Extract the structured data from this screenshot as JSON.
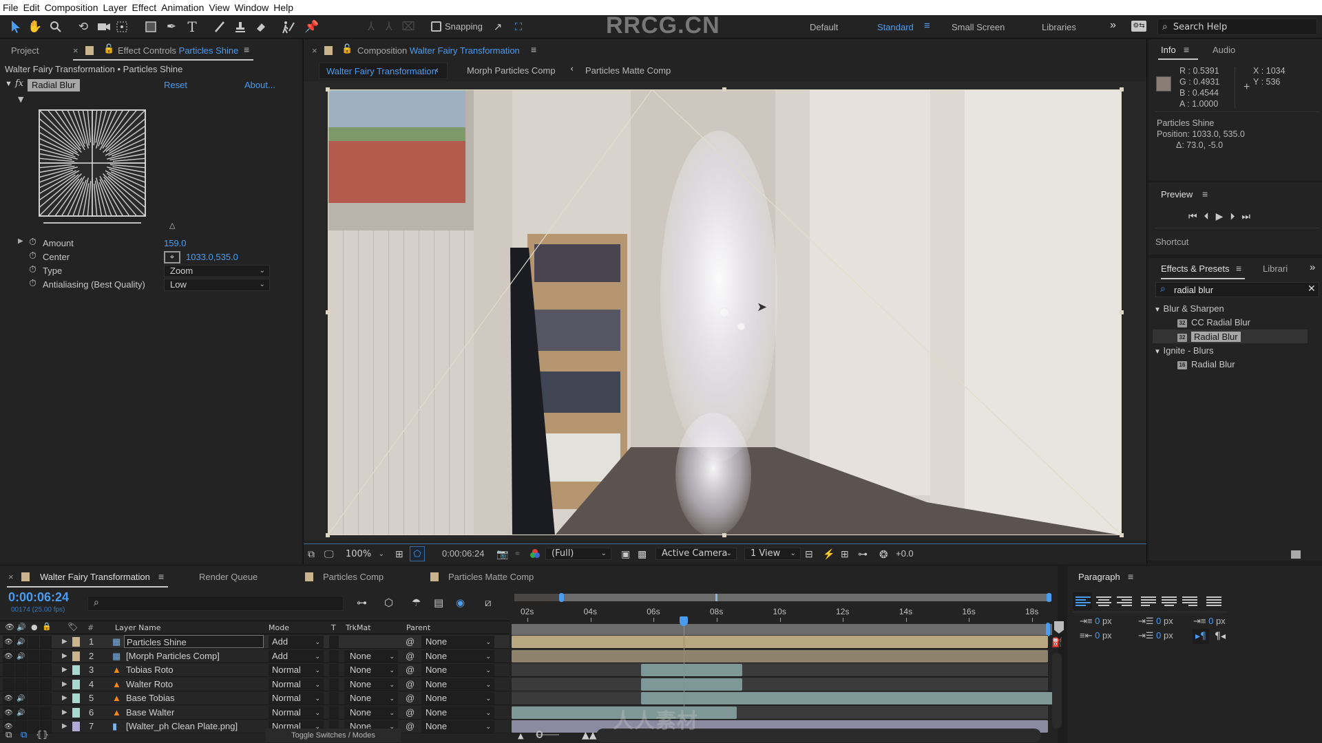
{
  "menubar": [
    "File",
    "Edit",
    "Composition",
    "Layer",
    "Effect",
    "Animation",
    "View",
    "Window",
    "Help"
  ],
  "toolbar": {
    "snapping_label": "Snapping",
    "workspaces": [
      "Default",
      "Standard",
      "Small Screen",
      "Libraries"
    ],
    "active_workspace": "Standard",
    "search_help_placeholder": "Search Help",
    "watermark": "RRCG.CN"
  },
  "left_panel": {
    "tab_project": "Project",
    "tab_effect_controls_prefix": "Effect Controls",
    "tab_effect_controls_layer": "Particles Shine",
    "breadcrumb": "Walter Fairy Transformation • Particles Shine",
    "effect": {
      "fx": "fx",
      "name": "Radial Blur",
      "reset": "Reset",
      "about": "About..."
    },
    "properties": [
      {
        "name": "Amount",
        "value": "159.0",
        "type": "number"
      },
      {
        "name": "Center",
        "value": "1033.0,535.0",
        "type": "point"
      },
      {
        "name": "Type",
        "value": "Zoom",
        "type": "dropdown"
      },
      {
        "name": "Antialiasing (Best Quality)",
        "value": "Low",
        "type": "dropdown"
      }
    ]
  },
  "composition": {
    "tab_prefix": "Composition",
    "tab_name": "Walter Fairy Transformation",
    "flow": [
      "Walter Fairy Transformation",
      "Morph Particles Comp",
      "Particles Matte Comp"
    ],
    "footer": {
      "zoom": "100%",
      "timecode": "0:00:06:24",
      "resolution": "(Full)",
      "camera": "Active Camera",
      "views": "1 View",
      "exposure": "+0.0"
    }
  },
  "info": {
    "tab_info": "Info",
    "tab_audio": "Audio",
    "swatch_color": "#8a7e74",
    "R": "0.5391",
    "G": "0.4931",
    "B": "0.4544",
    "A": "1.0000",
    "X": "1034",
    "Y": "536",
    "layer": "Particles Shine",
    "position": "Position: 1033.0, 535.0",
    "delta": "Δ: 73.0, -5.0"
  },
  "preview": {
    "title": "Preview",
    "shortcut_label": "Shortcut"
  },
  "effects_presets": {
    "tab": "Effects & Presets",
    "tab_libraries": "Librari",
    "search_value": "radial blur",
    "tree": [
      {
        "group": "Blur & Sharpen",
        "items": [
          {
            "badge": "32",
            "name": "CC Radial Blur"
          },
          {
            "badge": "32",
            "name": "Radial Blur",
            "selected": true
          }
        ]
      },
      {
        "group": "Ignite - Blurs",
        "items": [
          {
            "badge": "16",
            "name": "Radial Blur"
          }
        ]
      }
    ]
  },
  "timeline": {
    "tabs": [
      "Walter Fairy Transformation",
      "Render Queue",
      "Particles Comp",
      "Particles Matte Comp"
    ],
    "timecode": "0:00:06:24",
    "frames": "00174 (25.00 fps)",
    "columns": {
      "num": "#",
      "layer_name": "Layer Name",
      "mode": "Mode",
      "t": "T",
      "trkmat": "TrkMat",
      "parent": "Parent"
    },
    "layers": [
      {
        "num": "1",
        "name": "Particles Shine",
        "mode": "Add",
        "trkmat": "",
        "parent": "None",
        "type": "comp",
        "label": "#c9b48d",
        "visible": true,
        "audio": true,
        "start": 0,
        "end": 1,
        "bar": "#b9a781"
      },
      {
        "num": "2",
        "name": "[Morph Particles Comp]",
        "mode": "Add",
        "trkmat": "None",
        "parent": "None",
        "type": "comp",
        "label": "#c9b48d",
        "visible": true,
        "audio": true,
        "start": 0,
        "end": 1,
        "bar": "#8e826c"
      },
      {
        "num": "3",
        "name": "Tobias Roto",
        "mode": "Normal",
        "trkmat": "None",
        "parent": "None",
        "type": "footage",
        "label": "#a8d8d0",
        "visible": false,
        "audio": false,
        "start": 0.241,
        "end": 0.43,
        "bar": "#7d9896"
      },
      {
        "num": "4",
        "name": "Walter Roto",
        "mode": "Normal",
        "trkmat": "None",
        "parent": "None",
        "type": "footage",
        "label": "#a8d8d0",
        "visible": false,
        "audio": false,
        "start": 0.241,
        "end": 0.43,
        "bar": "#7d9896"
      },
      {
        "num": "5",
        "name": "Base Tobias",
        "mode": "Normal",
        "trkmat": "None",
        "parent": "None",
        "type": "footage",
        "label": "#a8d8d0",
        "visible": true,
        "audio": true,
        "start": 0.241,
        "end": 1.01,
        "bar": "#7d9896"
      },
      {
        "num": "6",
        "name": "Base Walter",
        "mode": "Normal",
        "trkmat": "None",
        "parent": "None",
        "type": "footage",
        "label": "#a8d8d0",
        "visible": true,
        "audio": true,
        "start": 0,
        "end": 0.42,
        "bar": "#7d9896"
      },
      {
        "num": "7",
        "name": "[Walter_ph Clean Plate.png]",
        "mode": "Normal",
        "trkmat": "None",
        "parent": "None",
        "type": "image",
        "label": "#b0a8d8",
        "visible": true,
        "audio": false,
        "start": 0,
        "end": 1,
        "bar": "#8c8aa0"
      }
    ],
    "ruler": [
      "02s",
      "04s",
      "06s",
      "08s",
      "10s",
      "12s",
      "14s",
      "16s",
      "18s"
    ],
    "current_time_s": 6.96,
    "toggle_label": "Toggle Switches / Modes"
  },
  "paragraph": {
    "title": "Paragraph",
    "indent_left": "0",
    "indent_first": "0",
    "space_before": "0",
    "indent_right": "0",
    "space_after": "0",
    "unit": "px"
  },
  "watermark_bottom": "人人素材"
}
